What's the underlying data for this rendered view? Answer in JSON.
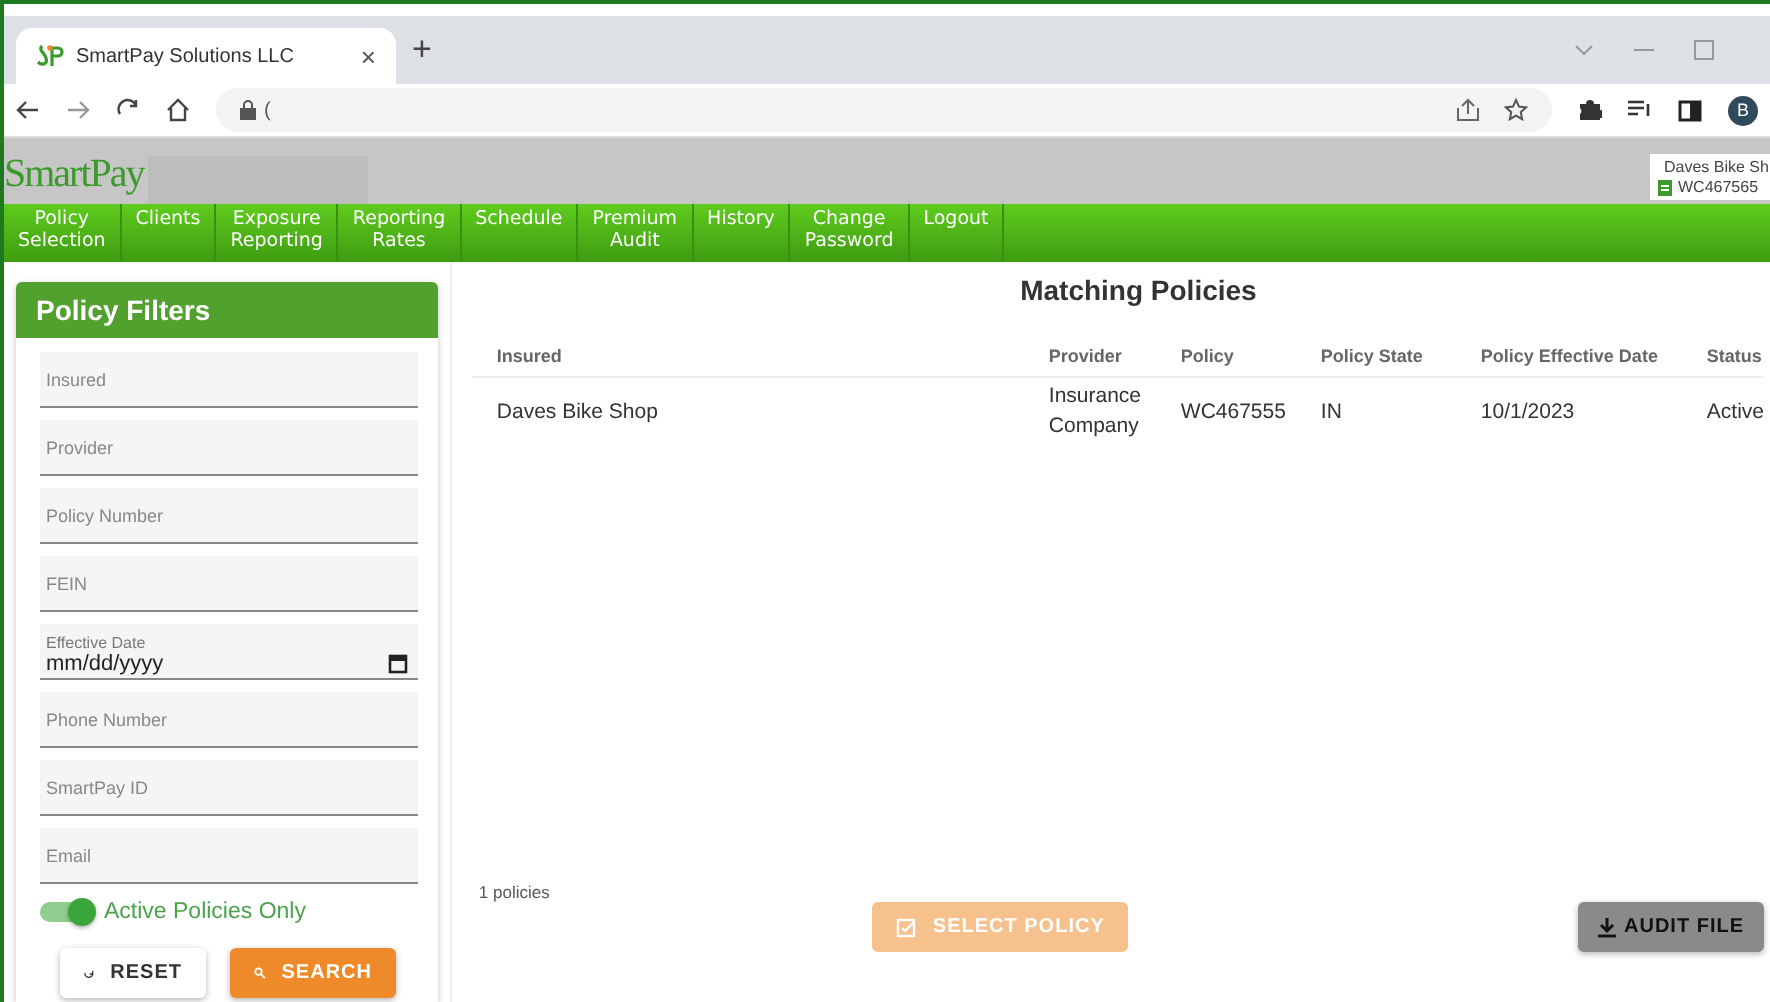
{
  "browser": {
    "tab_title": "SmartPay Solutions LLC",
    "tab_close": "×",
    "new_tab": "+",
    "address": "(",
    "profile_initial": "B"
  },
  "app": {
    "logo": "SmartPay",
    "account": {
      "name": "Daves Bike Sh",
      "policy": "WC467565"
    },
    "nav": [
      "Policy\nSelection",
      "Clients",
      "Exposure\nReporting",
      "Reporting\nRates",
      "Schedule",
      "Premium\nAudit",
      "History",
      "Change\nPassword",
      "Logout"
    ]
  },
  "filters": {
    "title": "Policy Filters",
    "fields": [
      {
        "kind": "text",
        "placeholder": "Insured"
      },
      {
        "kind": "text",
        "placeholder": "Provider"
      },
      {
        "kind": "text",
        "placeholder": "Policy Number"
      },
      {
        "kind": "text",
        "placeholder": "FEIN"
      },
      {
        "kind": "date",
        "label": "Effective Date",
        "value": "mm/dd/yyyy"
      },
      {
        "kind": "text",
        "placeholder": "Phone Number"
      },
      {
        "kind": "text",
        "placeholder": "SmartPay ID"
      },
      {
        "kind": "text",
        "placeholder": "Email"
      }
    ],
    "toggle": {
      "label": "Active Policies Only",
      "on": true
    },
    "reset_button": "RESET",
    "search_button": "SEARCH"
  },
  "results": {
    "title": "Matching Policies",
    "columns": [
      "Insured",
      "Provider",
      "Policy",
      "Policy State",
      "Policy Effective Date",
      "Status"
    ],
    "rows": [
      [
        "Daves Bike Shop",
        "Insurance\nCompany",
        "WC467555",
        "IN",
        "10/1/2023",
        "Active"
      ]
    ],
    "count": "1 policies",
    "select_button": {
      "label": "SELECT POLICY",
      "disabled": true
    },
    "audit_button": {
      "label": "AUDIT FILE",
      "disabled": false
    }
  }
}
